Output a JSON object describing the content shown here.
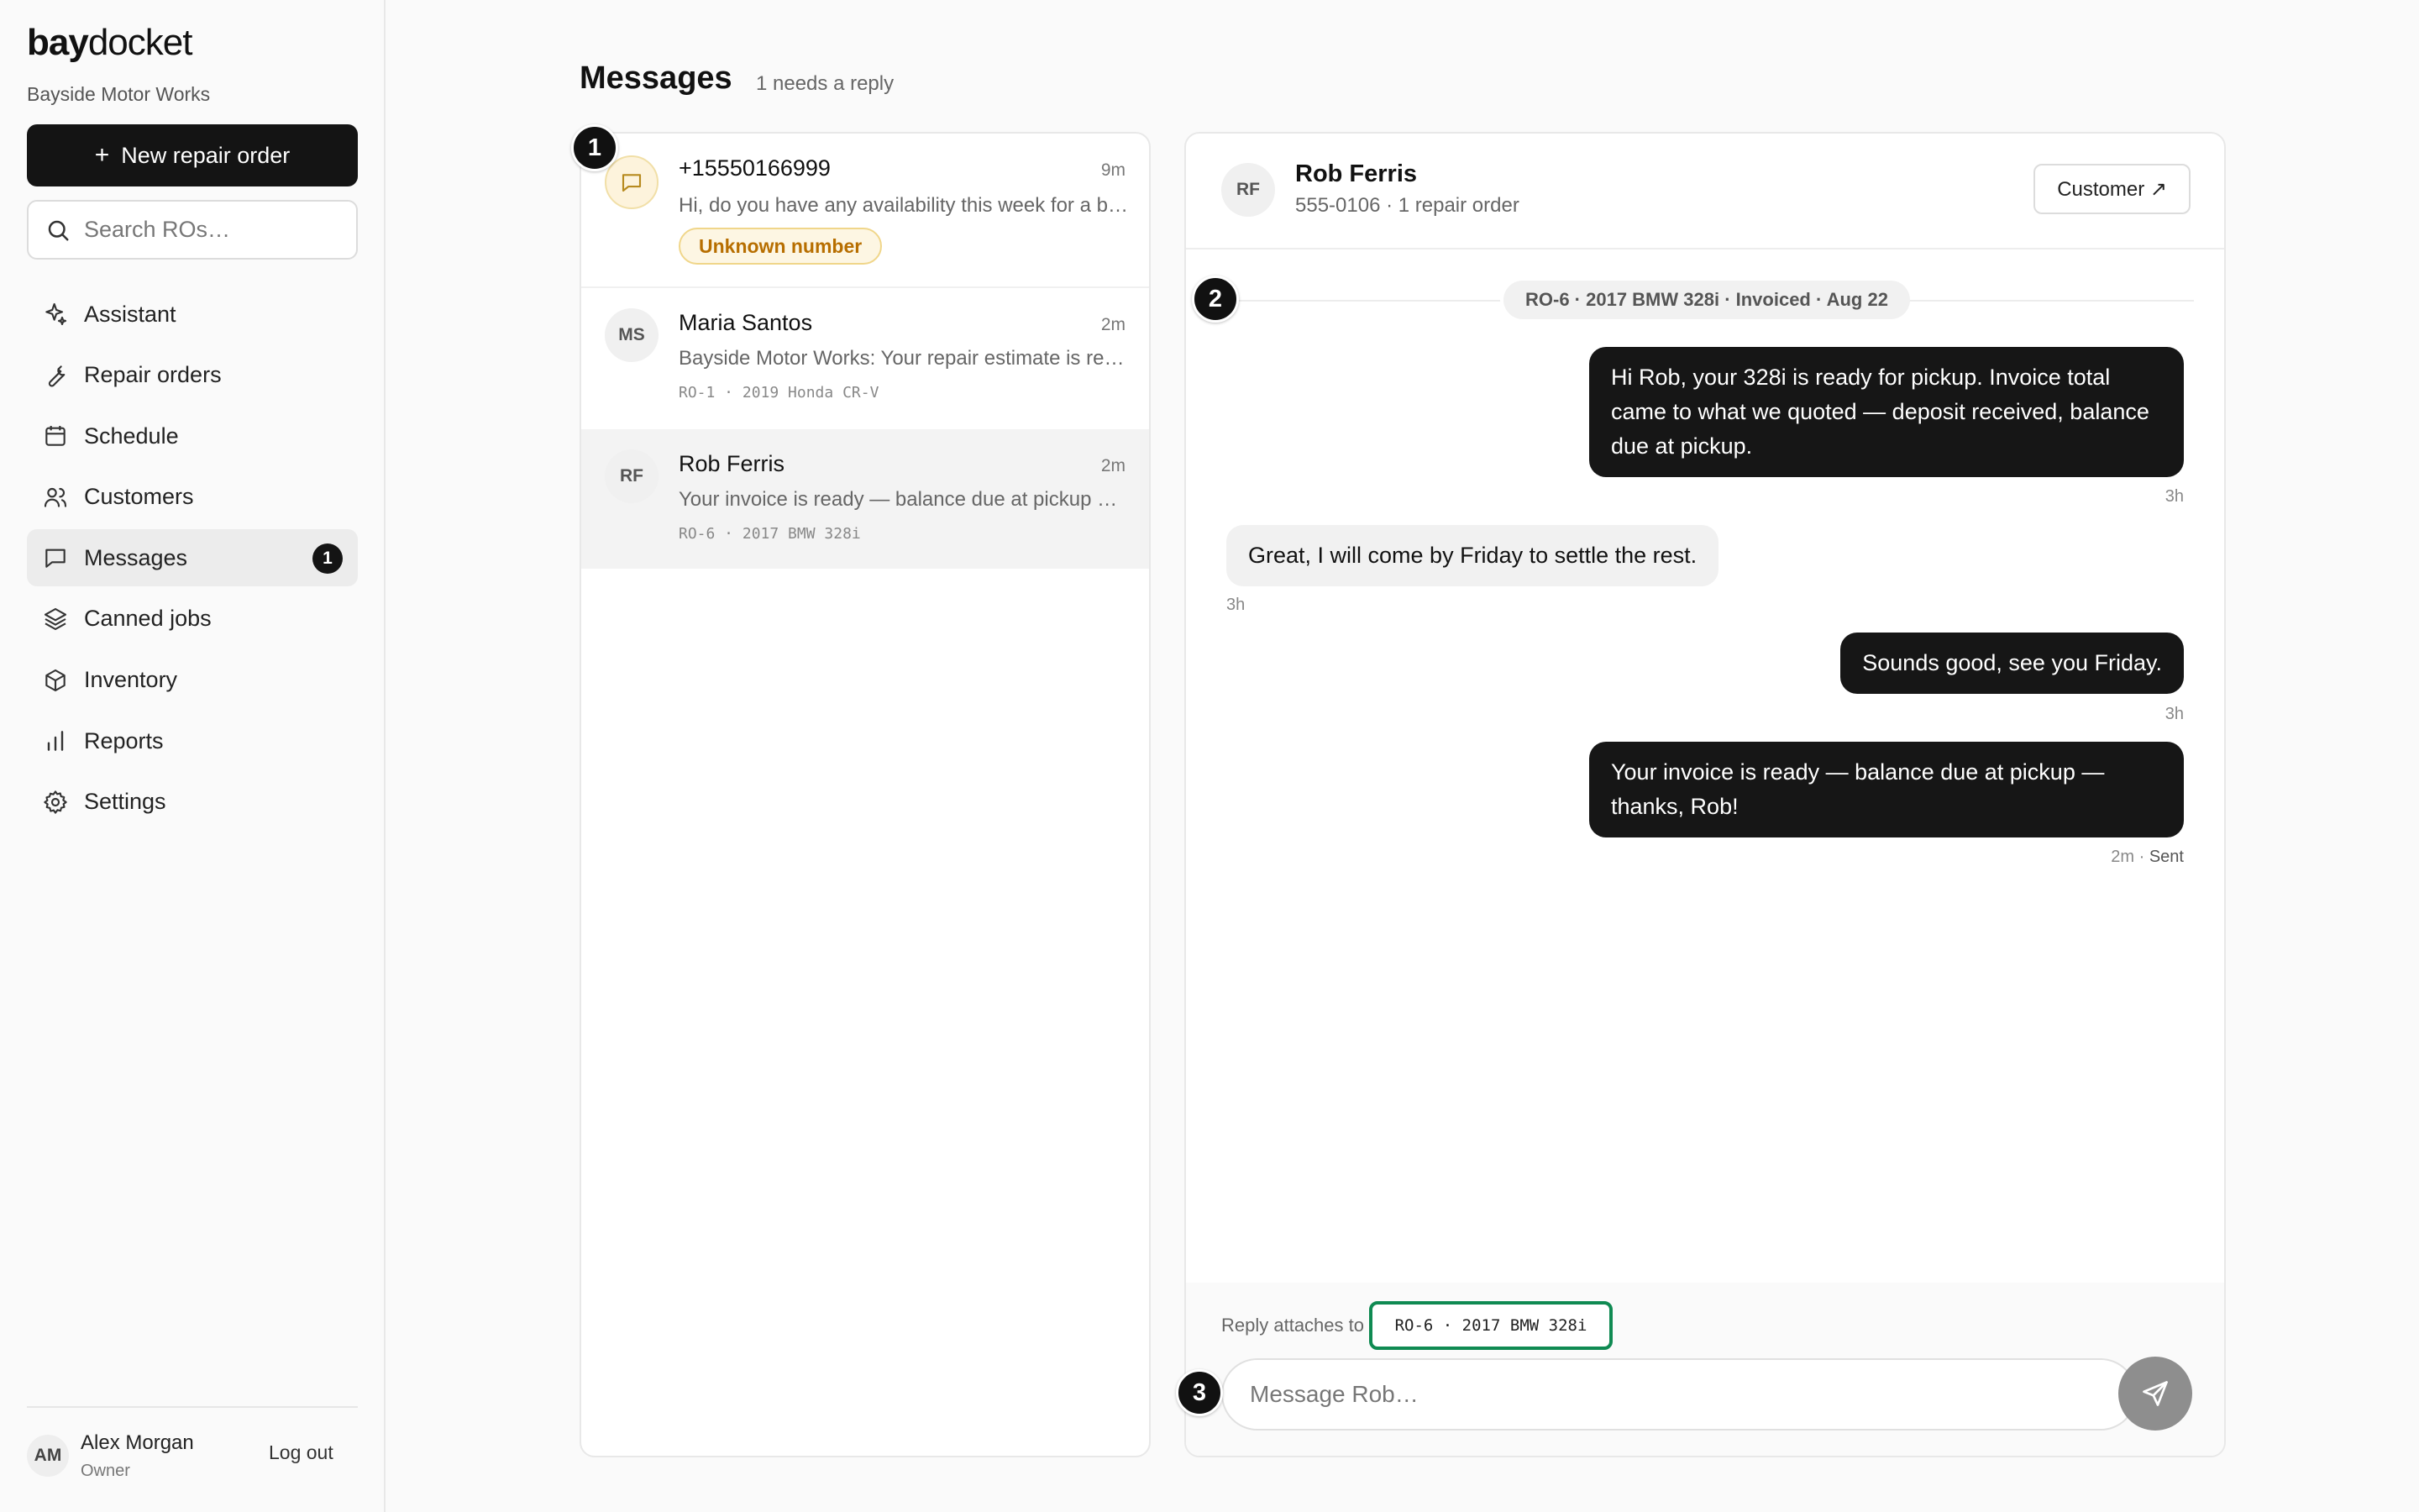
{
  "app": {
    "logo_bold": "bay",
    "logo_light": "docket",
    "shop_name": "Bayside Motor Works"
  },
  "sidebar": {
    "new_ro_label": "New repair order",
    "search_placeholder": "Search ROs…",
    "items": [
      {
        "label": "Assistant",
        "icon": "sparkle-icon"
      },
      {
        "label": "Repair orders",
        "icon": "wrench-icon"
      },
      {
        "label": "Schedule",
        "icon": "calendar-icon"
      },
      {
        "label": "Customers",
        "icon": "users-icon"
      },
      {
        "label": "Messages",
        "icon": "chat-icon",
        "active": true,
        "badge": "1"
      },
      {
        "label": "Canned jobs",
        "icon": "layers-icon"
      },
      {
        "label": "Inventory",
        "icon": "box-icon"
      },
      {
        "label": "Reports",
        "icon": "bar-chart-icon"
      },
      {
        "label": "Settings",
        "icon": "gear-icon"
      }
    ],
    "user": {
      "initials": "AM",
      "name": "Alex Morgan",
      "role": "Owner",
      "logout": "Log out"
    }
  },
  "main": {
    "title": "Messages",
    "subtitle": "1 needs a reply"
  },
  "conversations": [
    {
      "name": "+15550166999",
      "time": "9m",
      "preview": "Hi, do you have any availability this week for a brake inspection?",
      "badge": "Unknown number"
    },
    {
      "initials": "MS",
      "name": "Maria Santos",
      "time": "2m",
      "preview": "Bayside Motor Works: Your repair estimate is ready for review",
      "ro": "RO-1 · 2019 Honda CR-V"
    },
    {
      "initials": "RF",
      "name": "Rob Ferris",
      "time": "2m",
      "preview": "Your invoice is ready — balance due at pickup — thanks, Rob!",
      "ro": "RO-6 · 2017 BMW 328i",
      "selected": true
    }
  ],
  "thread": {
    "initials": "RF",
    "name": "Rob Ferris",
    "subtitle": "555-0106 · 1 repair order",
    "customer_button": "Customer ↗",
    "ro_divider": "RO-6 · 2017 BMW 328i · Invoiced · Aug 22",
    "messages": [
      {
        "dir": "out",
        "text": "Hi Rob, your 328i is ready for pickup. Invoice total came to what we quoted — deposit received, balance due at pickup.",
        "meta": "3h"
      },
      {
        "dir": "in",
        "text": "Great, I will come by Friday to settle the rest.",
        "meta": "3h"
      },
      {
        "dir": "out",
        "text": "Sounds good, see you Friday.",
        "meta": "3h"
      },
      {
        "dir": "out",
        "text": "Your invoice is ready — balance due at pickup — thanks, Rob!",
        "meta_time": "2m",
        "meta_status": "Sent"
      }
    ],
    "reply_attaches_label": "Reply attaches to",
    "reply_attaches_ro": "RO-6 · 2017 BMW 328i",
    "compose_placeholder": "Message Rob…"
  },
  "steps": [
    "1",
    "2",
    "3"
  ],
  "colors": {
    "accent_dark": "#141414",
    "attach_border": "#0f8a52",
    "unknown_badge": "#b76e00"
  }
}
